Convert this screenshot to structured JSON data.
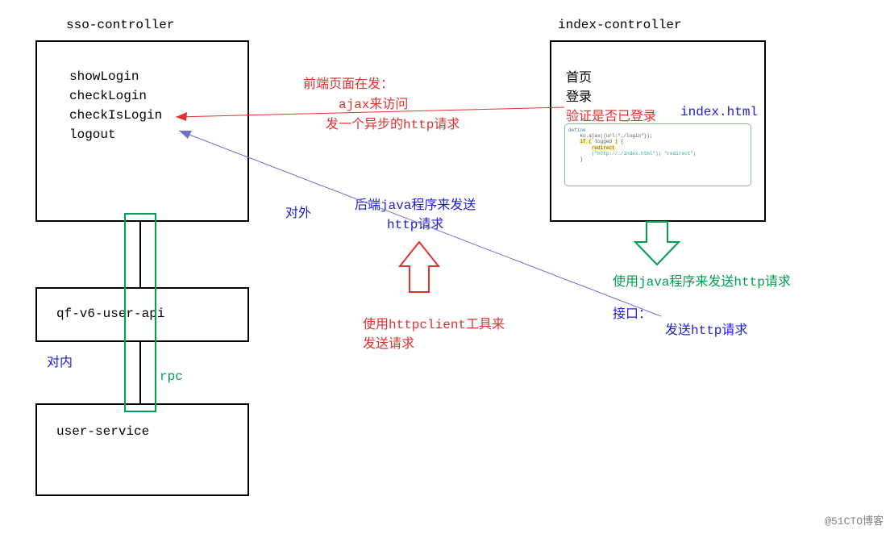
{
  "sso": {
    "title": "sso-controller",
    "methods": [
      "showLogin",
      "checkLogin",
      "checkIsLogin",
      "logout"
    ]
  },
  "index": {
    "title": "index-controller",
    "items": [
      "首页",
      "登录",
      "验证是否已登录"
    ],
    "filename": "index.html"
  },
  "api": {
    "name": "qf-v6-user-api"
  },
  "service": {
    "name": "user-service"
  },
  "annotations": {
    "internal": "对内",
    "rpc": "rpc",
    "external": "对外",
    "frontend_title": "前端页面在发：",
    "frontend_line1": "ajax来访问",
    "frontend_line2": "发一个异步的http请求",
    "backend_title": "后端java程序来发送",
    "backend_line1": "http请求",
    "httpclient_line1": "使用httpclient工具来",
    "httpclient_line2": "发送请求",
    "java_send": "使用java程序来发送http请求",
    "interface_label": "接口：",
    "send_http": "发送http请求"
  },
  "watermark": "@51CTO博客"
}
